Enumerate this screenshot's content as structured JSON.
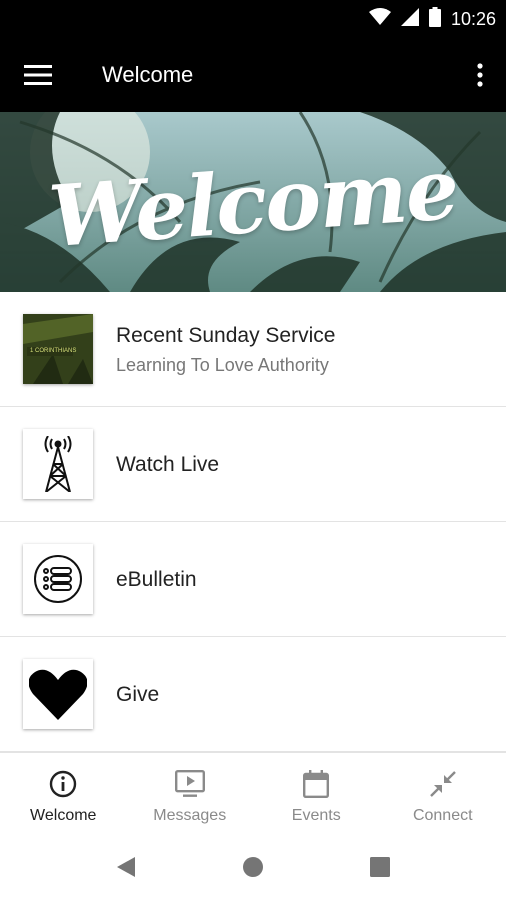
{
  "status_bar": {
    "time": "10:26",
    "icons": [
      "wifi-icon",
      "signal-icon",
      "battery-icon"
    ]
  },
  "app_bar": {
    "title": "Welcome",
    "menu_icon": "hamburger-menu-icon",
    "more_icon": "more-vertical-icon"
  },
  "banner": {
    "text": "Welcome"
  },
  "list": {
    "items": [
      {
        "title": "Recent Sunday Service",
        "subtitle": "Learning To Love Authority",
        "icon": "sermon-thumbnail",
        "thumb_text": "1 CORINTHIANS"
      },
      {
        "title": "Watch Live",
        "subtitle": "",
        "icon": "broadcast-tower-icon"
      },
      {
        "title": "eBulletin",
        "subtitle": "",
        "icon": "bulletin-list-icon"
      },
      {
        "title": "Give",
        "subtitle": "",
        "icon": "heart-icon"
      }
    ]
  },
  "bottom_nav": {
    "items": [
      {
        "label": "Welcome",
        "icon": "info-icon",
        "active": true
      },
      {
        "label": "Messages",
        "icon": "tv-play-icon",
        "active": false
      },
      {
        "label": "Events",
        "icon": "calendar-icon",
        "active": false
      },
      {
        "label": "Connect",
        "icon": "collapse-arrows-icon",
        "active": false
      }
    ]
  },
  "system_nav": {
    "buttons": [
      "back-icon",
      "home-icon",
      "recents-icon"
    ]
  },
  "colors": {
    "app_bar_bg": "#000000",
    "active_nav": "#222222",
    "inactive_nav": "#8a8a8a",
    "divider": "#e3e3e3"
  }
}
